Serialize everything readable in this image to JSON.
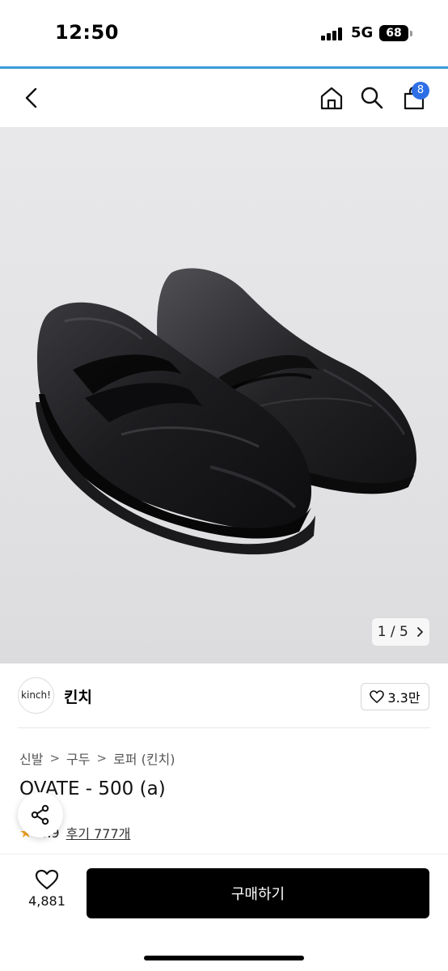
{
  "status_bar": {
    "time": "12:50",
    "network": "5G",
    "battery": "68"
  },
  "nav": {
    "cart_badge": "8"
  },
  "gallery": {
    "counter": "1 / 5",
    "counter_icon": "chevron-right-icon"
  },
  "brand": {
    "logo_text": "kinch!",
    "name": "킨치",
    "likes": "3.3만"
  },
  "breadcrumb": [
    "신발",
    "구두",
    "로퍼 (킨치)"
  ],
  "product": {
    "title": "OVATE - 500 (a)",
    "rating": "4.9",
    "reviews": "후기 777개"
  },
  "bottom": {
    "wish_count": "4,881",
    "buy_label": "구매하기"
  },
  "colors": {
    "accent_line": "#3a9ad9",
    "badge": "#2f6fe6",
    "buy_button": "#000000",
    "star": "#f5a623"
  }
}
